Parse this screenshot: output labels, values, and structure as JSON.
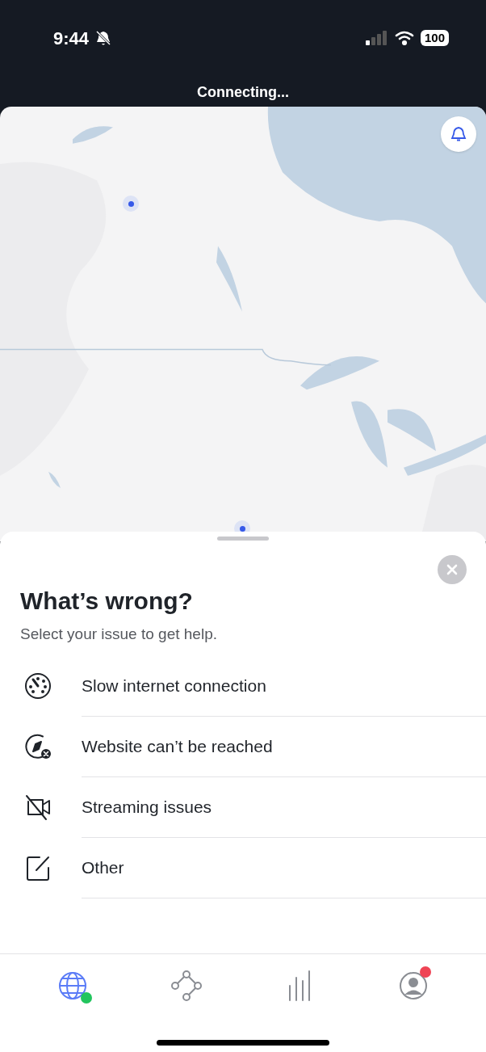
{
  "status_bar": {
    "time": "9:44",
    "silent": true,
    "battery": "100"
  },
  "connection_status": "Connecting...",
  "map": {
    "notifications_button": true
  },
  "sheet": {
    "title": "What’s wrong?",
    "subtitle": "Select your issue to get help.",
    "issues": [
      {
        "kind": "speed",
        "label": "Slow internet connection"
      },
      {
        "kind": "blocked",
        "label": "Website can’t be reached"
      },
      {
        "kind": "video",
        "label": "Streaming issues"
      },
      {
        "kind": "other",
        "label": "Other"
      }
    ]
  },
  "tabs": [
    {
      "kind": "globe",
      "selected": true,
      "color": "#22c55e"
    },
    {
      "kind": "mesh",
      "selected": false
    },
    {
      "kind": "stats",
      "selected": false
    },
    {
      "kind": "profile",
      "selected": false,
      "color": "#ef4455"
    }
  ]
}
